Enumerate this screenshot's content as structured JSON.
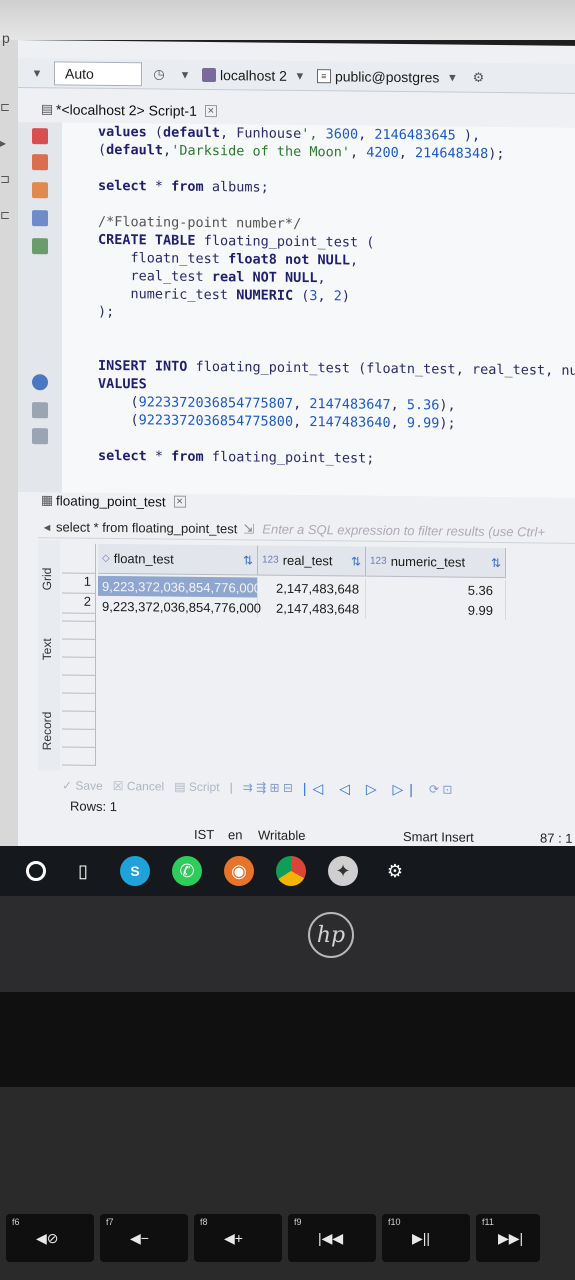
{
  "toolbar": {
    "mode": "Auto",
    "connection": "localhost 2",
    "schema": "public@postgres"
  },
  "editor_tab": {
    "title": "*<localhost 2> Script-1"
  },
  "code_lines": [
    "values (default, Funhouse', 3600, 2146483645 ),",
    "(default,'Darkside of the Moon', 4200, 214648348);",
    "",
    "select * from albums;",
    "",
    "/*Floating-point number*/",
    "CREATE TABLE floating_point_test (",
    "    floatn_test float8 not NULL,",
    "    real_test real NOT NULL,",
    "    numeric_test NUMERIC (3, 2)",
    ");",
    "",
    "",
    "INSERT INTO floating_point_test (floatn_test, real_test, nu",
    "VALUES",
    "    (9223372036854775807, 2147483647, 5.36),",
    "    (9223372036854775800, 2147483640, 9.99);",
    "",
    "select * from floating_point_test;"
  ],
  "results": {
    "tab_title": "floating_point_test",
    "query": "select * from floating_point_test",
    "filter_placeholder": "Enter a SQL expression to filter results (use Ctrl+",
    "side_tabs": [
      "Grid",
      "Text",
      "Record"
    ],
    "type_label": "123",
    "columns": [
      "floatn_test",
      "real_test",
      "numeric_test"
    ],
    "rows": [
      {
        "num": "1",
        "floatn_test": "9,223,372,036,854,776,000",
        "real_test": "2,147,483,648",
        "numeric_test": "5.36"
      },
      {
        "num": "2",
        "floatn_test": "9,223,372,036,854,776,000",
        "real_test": "2,147,483,648",
        "numeric_test": "9.99"
      }
    ],
    "buttons": {
      "save": "Save",
      "cancel": "Cancel",
      "script": "Script"
    },
    "rows_count": "Rows: 1"
  },
  "status": {
    "timezone": "IST",
    "locale": "en",
    "mode": "Writable",
    "insert": "Smart Insert",
    "position": "87 : 1"
  },
  "laptop": {
    "brand": "hp",
    "fn_keys": [
      {
        "fn": "f6",
        "icon": "mute-icon"
      },
      {
        "fn": "f7",
        "icon": "volume-down-icon"
      },
      {
        "fn": "f8",
        "icon": "volume-up-icon"
      },
      {
        "fn": "f9",
        "icon": "previous-track-icon"
      },
      {
        "fn": "f10",
        "icon": "play-pause-icon"
      },
      {
        "fn": "f11",
        "icon": "next-track-icon"
      }
    ]
  },
  "colors": {
    "selected_cell": "#8fa6cf",
    "taskbar": "#15181c",
    "editor_bg": "#f7f8fa"
  }
}
